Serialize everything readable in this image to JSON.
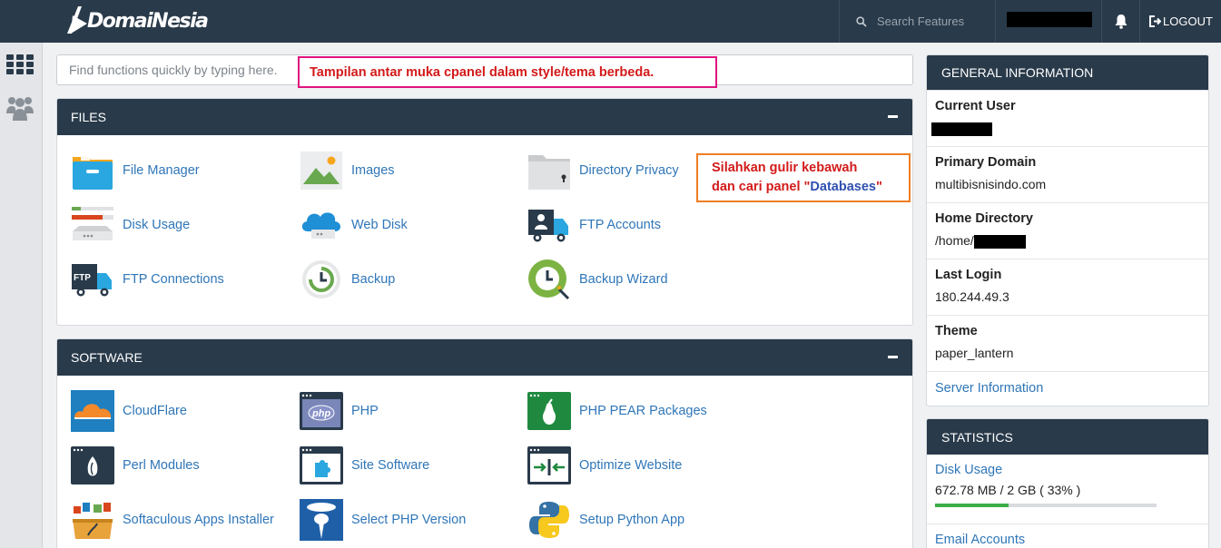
{
  "header": {
    "logo_text": "DomaiNesia",
    "search_placeholder": "Search Features",
    "logout_label": "LOGOUT"
  },
  "rail": {
    "items": [
      "home-grid-icon",
      "users-icon"
    ]
  },
  "quick_search": {
    "placeholder": "Find functions quickly by typing here."
  },
  "annotations": {
    "pink_note": "Tampilan antar muka cpanel dalam style/tema berbeda.",
    "orange_note_line1": "Silahkan gulir kebawah",
    "orange_note_line2_prefix": "dan cari panel \"",
    "orange_note_highlight": "Databases",
    "orange_note_line2_suffix": "\""
  },
  "files_panel": {
    "title": "FILES",
    "items": [
      {
        "label": "File Manager",
        "icon": "file-manager-icon"
      },
      {
        "label": "Images",
        "icon": "images-icon"
      },
      {
        "label": "Directory Privacy",
        "icon": "directory-privacy-icon"
      },
      {
        "label": "Disk Usage",
        "icon": "disk-usage-icon"
      },
      {
        "label": "Web Disk",
        "icon": "web-disk-icon"
      },
      {
        "label": "FTP Accounts",
        "icon": "ftp-accounts-icon"
      },
      {
        "label": "FTP Connections",
        "icon": "ftp-connections-icon"
      },
      {
        "label": "Backup",
        "icon": "backup-icon"
      },
      {
        "label": "Backup Wizard",
        "icon": "backup-wizard-icon"
      }
    ]
  },
  "software_panel": {
    "title": "SOFTWARE",
    "items": [
      {
        "label": "CloudFlare",
        "icon": "cloudflare-icon"
      },
      {
        "label": "PHP",
        "icon": "php-icon"
      },
      {
        "label": "PHP PEAR Packages",
        "icon": "php-pear-icon"
      },
      {
        "label": "Perl Modules",
        "icon": "perl-modules-icon"
      },
      {
        "label": "Site Software",
        "icon": "site-software-icon"
      },
      {
        "label": "Optimize Website",
        "icon": "optimize-website-icon"
      },
      {
        "label": "Softaculous Apps Installer",
        "icon": "softaculous-icon"
      },
      {
        "label": "Select PHP Version",
        "icon": "select-php-version-icon"
      },
      {
        "label": "Setup Python App",
        "icon": "python-icon"
      }
    ]
  },
  "general_info": {
    "title": "GENERAL INFORMATION",
    "current_user_label": "Current User",
    "primary_domain_label": "Primary Domain",
    "primary_domain_value": "multibisnisindo.com",
    "home_directory_label": "Home Directory",
    "home_directory_prefix": "/home/",
    "last_login_label": "Last Login",
    "last_login_value": "180.244.49.3",
    "theme_label": "Theme",
    "theme_value": "paper_lantern",
    "server_info_link": "Server Information"
  },
  "statistics": {
    "title": "STATISTICS",
    "disk_usage_label": "Disk Usage",
    "disk_usage_value": "672.78 MB / 2 GB ( 33% )",
    "disk_usage_fraction": 0.33,
    "email_accounts_label": "Email Accounts"
  },
  "colors": {
    "navy": "#293a4a",
    "link": "#2f76b8",
    "pink_border": "#e0127e",
    "orange_border": "#ef7d22",
    "note_text": "#d31a1a",
    "progress": "#3bae49"
  }
}
